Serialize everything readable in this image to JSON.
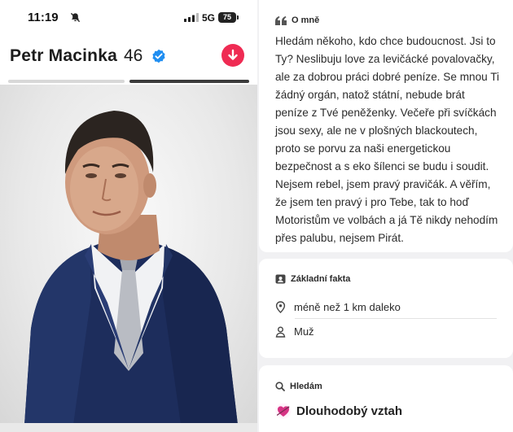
{
  "status_bar": {
    "time": "11:19",
    "network": "5G",
    "battery": "75"
  },
  "profile": {
    "name": "Petr Macinka",
    "age": "46",
    "verified": true,
    "photo_count": 2,
    "active_photo": 2
  },
  "about": {
    "heading": "O mně",
    "text": "Hledám někoho, kdo chce budoucnost. Jsi to Ty? Neslibuju love za levičácké povalovačky, ale za dobrou práci dobré peníze. Se mnou Ti žádný orgán, natož státní, nebude brát peníze z Tvé peněženky. Večeře při svíčkách jsou sexy, ale ne v plošných blackoutech, proto se porvu za naši energetickou bezpečnost a s eko šílenci se budu i soudit. Nejsem rebel, jsem pravý pravičák. A věřím, že jsem ten pravý i pro Tebe, tak to hoď Motoristům ve volbách a já Tě nikdy nehodím přes palubu, nejsem Pirát."
  },
  "facts": {
    "heading": "Základní fakta",
    "distance": "méně než 1 km daleko",
    "gender": "Muž"
  },
  "looking_for": {
    "heading": "Hledám",
    "value": "Dlouhodobý vztah"
  },
  "colors": {
    "accent_red": "#ef2b53",
    "verified_blue": "#1f8ef1",
    "goal_heart": "#d63384"
  },
  "icons": {
    "about": "quote-icon",
    "facts": "id-card-icon",
    "distance": "location-pin-icon",
    "gender": "person-icon",
    "looking": "search-icon",
    "goal": "heart-arrow-icon"
  }
}
